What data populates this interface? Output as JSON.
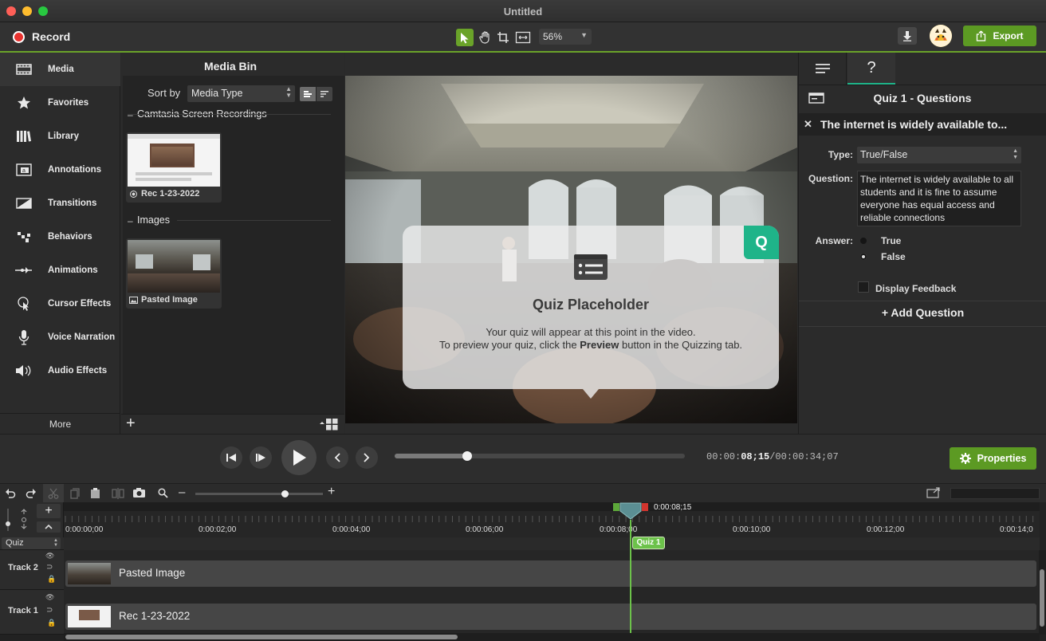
{
  "window": {
    "title": "Untitled"
  },
  "toolbar": {
    "record_label": "Record",
    "zoom_value": "56%",
    "export_label": "Export"
  },
  "nav": {
    "items": [
      {
        "label": "Media",
        "icon": "film-icon"
      },
      {
        "label": "Favorites",
        "icon": "star-icon"
      },
      {
        "label": "Library",
        "icon": "library-icon"
      },
      {
        "label": "Annotations",
        "icon": "annotation-icon"
      },
      {
        "label": "Transitions",
        "icon": "transition-icon"
      },
      {
        "label": "Behaviors",
        "icon": "behaviors-icon"
      },
      {
        "label": "Animations",
        "icon": "animation-icon"
      },
      {
        "label": "Cursor Effects",
        "icon": "cursor-effects-icon"
      },
      {
        "label": "Voice Narration",
        "icon": "microphone-icon"
      },
      {
        "label": "Audio Effects",
        "icon": "speaker-icon"
      }
    ],
    "more_label": "More"
  },
  "media_bin": {
    "title": "Media Bin",
    "sort_label": "Sort by",
    "sort_value": "Media Type",
    "groups": [
      {
        "name": "Camtasia Screen Recordings",
        "items": [
          {
            "label": "Rec 1-23-2022"
          }
        ]
      },
      {
        "name": "Images",
        "items": [
          {
            "label": "Pasted Image"
          }
        ]
      }
    ]
  },
  "quiz_overlay": {
    "badge": "Q",
    "title": "Quiz Placeholder",
    "line1": "Your quiz will appear at this point in the video.",
    "line2_prefix": "To preview your quiz, click the ",
    "line2_bold": "Preview",
    "line2_suffix": " button in the Quizzing tab."
  },
  "properties_panel": {
    "tab_help": "?",
    "header": "Quiz 1 - Questions",
    "question_title": "The internet is widely available to...",
    "type_label": "Type:",
    "type_value": "True/False",
    "question_label": "Question:",
    "question_text": "The internet is widely available to all students and it is fine to assume everyone has equal access and reliable connections",
    "answer_label": "Answer:",
    "answers": [
      "True",
      "False"
    ],
    "feedback_label": "Display Feedback",
    "add_question": "+ Add Question"
  },
  "playback": {
    "time_current_prefix": "00:00:",
    "time_current_bold": "08;15",
    "time_total": "/00:00:34;07",
    "progress": 0.25,
    "properties_label": "Properties"
  },
  "timeline": {
    "playhead_time": "0:00:08;15",
    "ruler": [
      "0:00:00;00",
      "0:00:02;00",
      "0:00:04;00",
      "0:00:06;00",
      "0:00:08;00",
      "0:00:10;00",
      "0:00:12;00",
      "0:00:14;0"
    ],
    "quiz_track_label": "Quiz",
    "quiz_marker": "Quiz 1",
    "tracks": [
      {
        "name": "Track 2",
        "clip": "Pasted Image"
      },
      {
        "name": "Track 1",
        "clip": "Rec 1-23-2022"
      }
    ]
  },
  "colors": {
    "accent": "#6aa329",
    "quiz_teal": "#1fb489",
    "record_red": "#e8322f"
  }
}
